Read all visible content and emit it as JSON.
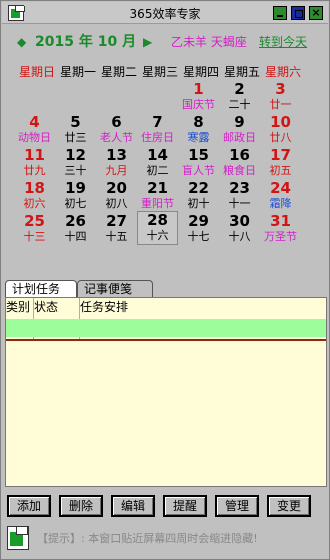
{
  "titlebar": {
    "title": "365效率专家",
    "close_glyph": "×"
  },
  "header": {
    "prev_arrow": "◆",
    "next_arrow": "▶",
    "month_label": "2015 年  10 月",
    "ganzhi": "乙未羊  天蝎座",
    "goto_today": "转到今天"
  },
  "weekdays": [
    "星期日",
    "星期一",
    "星期二",
    "星期三",
    "星期四",
    "星期五",
    "星期六"
  ],
  "calendar": {
    "cells": [
      {
        "num": "1",
        "sub": "国庆节"
      },
      {
        "num": "2",
        "sub": "二十"
      },
      {
        "num": "3",
        "sub": "廿一"
      },
      {
        "num": "4",
        "sub": "动物日"
      },
      {
        "num": "5",
        "sub": "廿三"
      },
      {
        "num": "6",
        "sub": "老人节"
      },
      {
        "num": "7",
        "sub": "住房日"
      },
      {
        "num": "8",
        "sub": "寒露"
      },
      {
        "num": "9",
        "sub": "邮政日"
      },
      {
        "num": "10",
        "sub": "廿八"
      },
      {
        "num": "11",
        "sub": "廿九"
      },
      {
        "num": "12",
        "sub": "三十"
      },
      {
        "num": "13",
        "sub": "九月"
      },
      {
        "num": "14",
        "sub": "初二"
      },
      {
        "num": "15",
        "sub": "盲人节"
      },
      {
        "num": "16",
        "sub": "粮食日"
      },
      {
        "num": "17",
        "sub": "初五"
      },
      {
        "num": "18",
        "sub": "初六"
      },
      {
        "num": "19",
        "sub": "初七"
      },
      {
        "num": "20",
        "sub": "初八"
      },
      {
        "num": "21",
        "sub": "重阳节"
      },
      {
        "num": "22",
        "sub": "初十"
      },
      {
        "num": "23",
        "sub": "十一"
      },
      {
        "num": "24",
        "sub": "霜降"
      },
      {
        "num": "25",
        "sub": "十三"
      },
      {
        "num": "26",
        "sub": "十四"
      },
      {
        "num": "27",
        "sub": "十五"
      },
      {
        "num": "28",
        "sub": "十六"
      },
      {
        "num": "29",
        "sub": "十七"
      },
      {
        "num": "30",
        "sub": "十八"
      },
      {
        "num": "31",
        "sub": "万圣节"
      }
    ]
  },
  "tabs": {
    "tasks": "计划任务",
    "notes": "记事便笺"
  },
  "task_table": {
    "col_type": "类别",
    "col_status": "状态",
    "col_task": "任务安排"
  },
  "buttons": {
    "add": "添加",
    "delete": "删除",
    "edit": "编辑",
    "remind": "提醒",
    "manage": "管理",
    "change": "变更"
  },
  "footer": {
    "hint": "【提示】: 本窗口贴近屏幕四周时会缩进隐藏!"
  },
  "colors": {
    "weekend_red": "#d21414",
    "festival_magenta": "#d41ec8",
    "solar_term_blue": "#1d4fd6",
    "header_green": "#1a8a2a",
    "selected_row_green": "#9cfd9a",
    "task_panel_bg": "#fffcd8"
  }
}
